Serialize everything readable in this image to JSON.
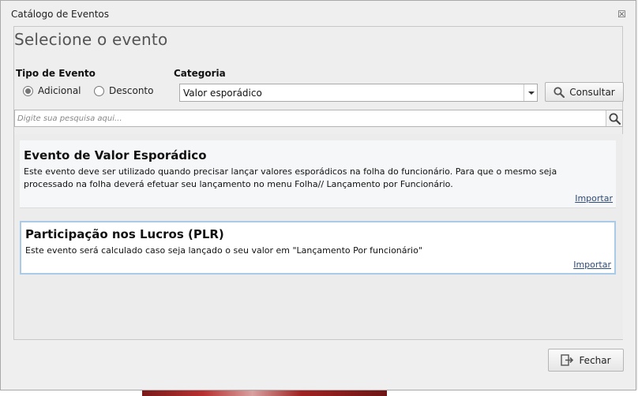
{
  "window": {
    "title": "Catálogo de Eventos",
    "close_glyph": "☒"
  },
  "heading": "Selecione o evento",
  "tipo_evento": {
    "label": "Tipo de Evento",
    "options": [
      {
        "label": "Adicional",
        "selected": true
      },
      {
        "label": "Desconto",
        "selected": false
      }
    ]
  },
  "categoria": {
    "label": "Categoria",
    "value": "Valor esporádico"
  },
  "consultar_label": "Consultar",
  "search": {
    "placeholder": "Digite sua pesquisa aqui..."
  },
  "events": [
    {
      "title": "Evento de Valor Esporádico",
      "description": "Este evento deve ser utilizado quando precisar lançar valores esporádicos na folha do funcionário. Para que o mesmo seja processado na folha deverá efetuar seu lançamento no menu Folha// Lançamento por Funcionário.",
      "action": "Importar"
    },
    {
      "title": "Participação nos Lucros (PLR)",
      "description": "Este evento será calculado caso seja lançado o seu valor em \"Lançamento Por funcionário\"",
      "action": "Importar",
      "selected": true
    }
  ],
  "fechar_label": "Fechar",
  "icons": {
    "consultar": "search-icon",
    "search": "search-icon",
    "fechar": "exit-icon",
    "close": "close-icon"
  },
  "colors": {
    "selected_border": "#a9cbe8",
    "link": "#2c4a7a"
  }
}
